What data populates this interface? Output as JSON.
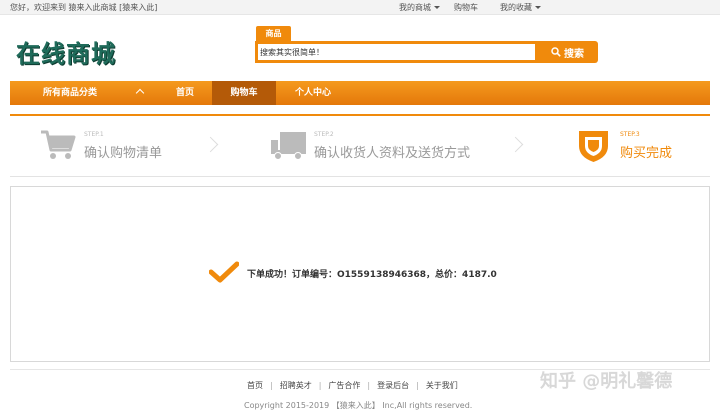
{
  "topbar": {
    "welcome_prefix": "您好，欢迎来到",
    "welcome_link": "猿来入此商城",
    "welcome_tag": "[猿来入此]",
    "my_mall": "我的商城",
    "cart": "购物车",
    "favorites": "我的收藏"
  },
  "header": {
    "logo": "在线商城",
    "search_tab": "商品",
    "search_value": "搜索其实很简单！",
    "search_button": "搜索"
  },
  "nav": {
    "category": "所有商品分类",
    "items": [
      {
        "label": "首页"
      },
      {
        "label": "购物车"
      },
      {
        "label": "个人中心"
      }
    ]
  },
  "steps": [
    {
      "step": "STEP.1",
      "text": "确认购物清单",
      "icon": "cart-icon"
    },
    {
      "step": "STEP.2",
      "text": "确认收货人资料及送货方式",
      "icon": "truck-icon"
    },
    {
      "step": "STEP.3",
      "text": "购买完成",
      "icon": "shield-icon"
    }
  ],
  "result": {
    "message": "下单成功！订单编号：O1559138946368，总价：4187.0"
  },
  "footer": {
    "links": [
      "首页",
      "招聘英才",
      "广告合作",
      "登录后台",
      "关于我们"
    ],
    "copyright": "Copyright 2015-2019 【猿来入此】 Inc,All rights reserved."
  },
  "watermark": "知乎 @明礼馨德",
  "colors": {
    "accent": "#f08a0c",
    "nav_active": "#b45a08",
    "logo": "#1f6b5a"
  }
}
